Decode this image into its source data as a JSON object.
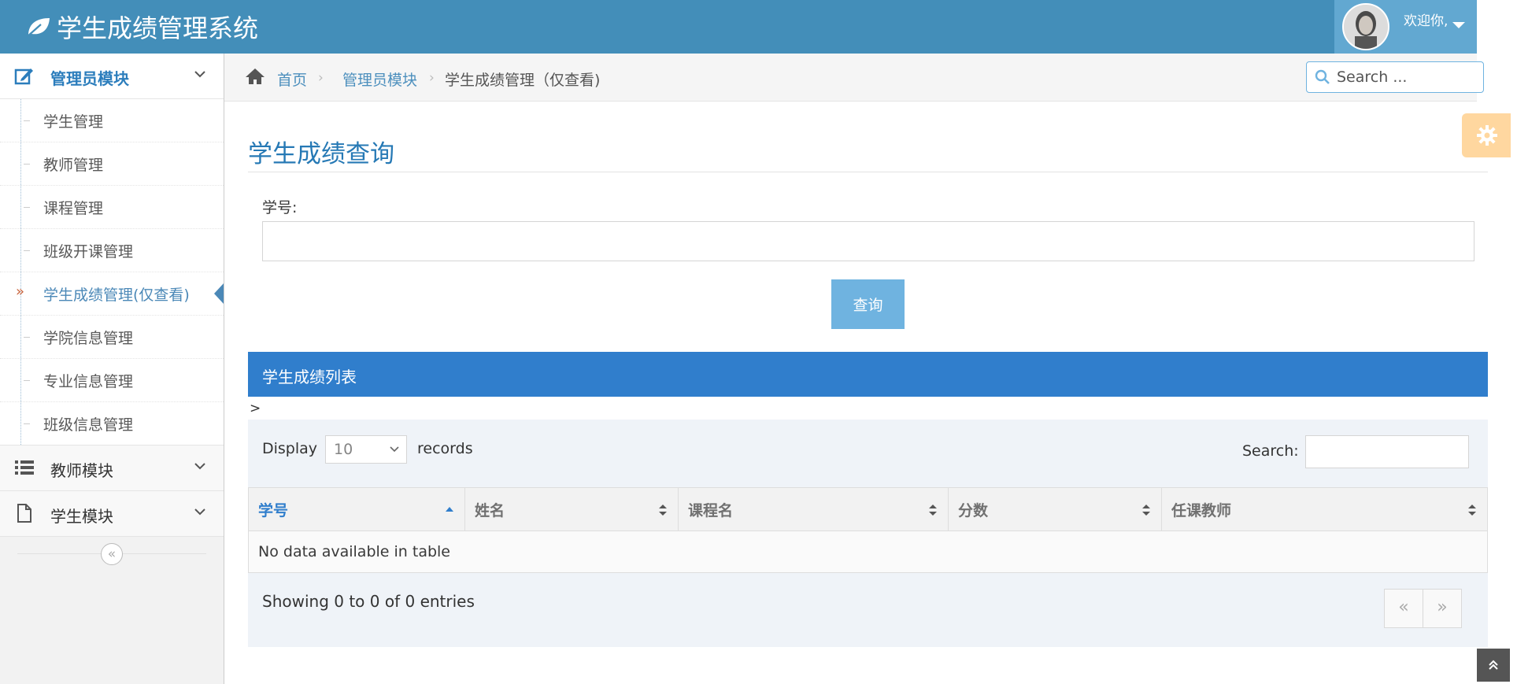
{
  "app": {
    "title": "学生成绩管理系统"
  },
  "user": {
    "welcome": "欢迎你,"
  },
  "sidebar": {
    "sections": [
      {
        "label": "管理员模块"
      },
      {
        "label": "教师模块"
      },
      {
        "label": "学生模块"
      }
    ],
    "admin_items": [
      {
        "label": "学生管理"
      },
      {
        "label": "教师管理"
      },
      {
        "label": "课程管理"
      },
      {
        "label": "班级开课管理"
      },
      {
        "label": "学生成绩管理(仅查看)"
      },
      {
        "label": "学院信息管理"
      },
      {
        "label": "专业信息管理"
      },
      {
        "label": "班级信息管理"
      }
    ],
    "active_item": "学生成绩管理(仅查看)"
  },
  "breadcrumb": {
    "home": "首页",
    "module": "管理员模块",
    "current": "学生成绩管理（仅查看)"
  },
  "nav_search": {
    "placeholder": "Search ..."
  },
  "page": {
    "title": "学生成绩查询",
    "student_id_label": "学号:",
    "query_button": "查询"
  },
  "table": {
    "header_title": "学生成绩列表",
    "stray_text": ">",
    "display_label": "Display",
    "page_size": "10",
    "records_label": "records",
    "search_label": "Search:",
    "columns": [
      "学号",
      "姓名",
      "课程名",
      "分数",
      "任课教师"
    ],
    "sorted_column": "学号",
    "empty_message": "No data available in table",
    "info": "Showing 0 to 0 of 0 entries",
    "pager": {
      "prev": "«",
      "next": "»"
    }
  },
  "icons": {
    "brand": "leaf-icon",
    "gear": "gear-icon",
    "home": "home-icon",
    "search": "search-icon",
    "collapse": "double-chevron-left-icon",
    "scroll_top": "double-chevron-up-icon"
  },
  "colors": {
    "navbar": "#438eb9",
    "user_box": "#62a8d1",
    "accent": "#307ecc",
    "query_button": "#6fb3e0",
    "gear_box": "#ffb752"
  }
}
